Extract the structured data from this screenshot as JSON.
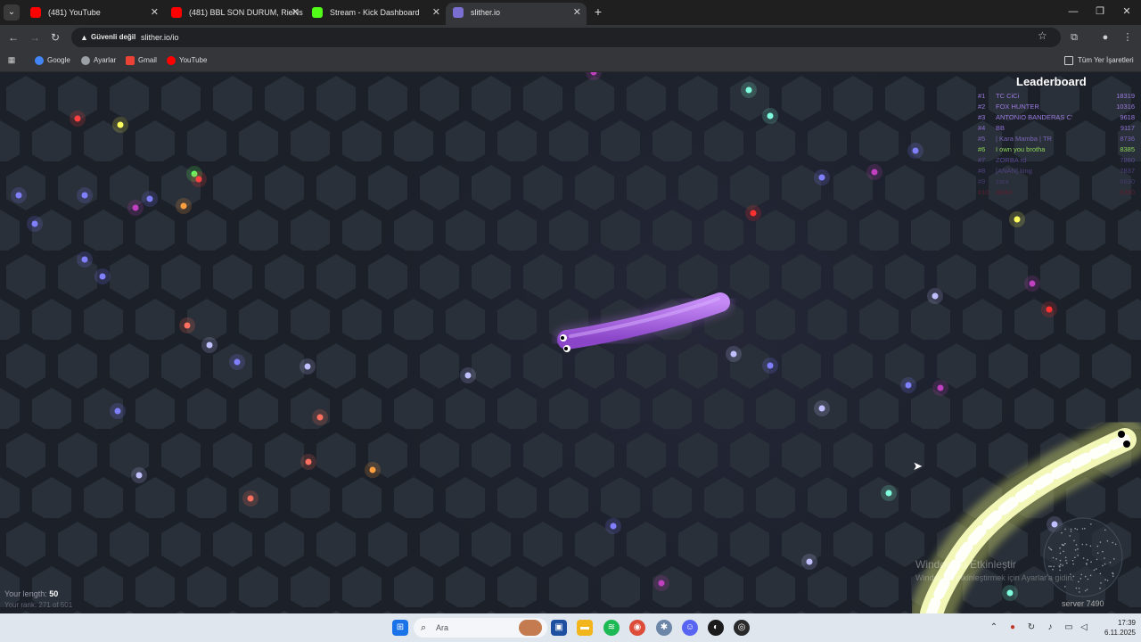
{
  "browser": {
    "tabs": [
      {
        "title": "(481) YouTube",
        "fav_color": "#ff0000",
        "active": false
      },
      {
        "title": "(481) BBL SON DURUM, RieNs",
        "fav_color": "#ff0000",
        "active": false
      },
      {
        "title": "Stream - Kick Dashboard",
        "fav_color": "#53fc18",
        "active": false
      },
      {
        "title": "slither.io",
        "fav_color": "#7a6fd0",
        "active": true
      }
    ],
    "insecure_label": "Güvenli değil",
    "url": "slither.io/io",
    "bookmarks": [
      {
        "label": "Google",
        "color": "#4285f4"
      },
      {
        "label": "Ayarlar",
        "color": "#9aa0a6"
      },
      {
        "label": "Gmail",
        "color": "#ea4335"
      },
      {
        "label": "YouTube",
        "color": "#ff0000"
      }
    ],
    "all_bookmarks_label": "Tüm Yer İşaretleri"
  },
  "leaderboard": {
    "title": "Leaderboard",
    "rows": [
      {
        "rank": "#1",
        "name": "TC CiCi",
        "score": "18319",
        "color": "#9b7be0"
      },
      {
        "rank": "#2",
        "name": "FOX HUNTER",
        "score": "10316",
        "color": "#9b7be0"
      },
      {
        "rank": "#3",
        "name": "ANTONIO BANDERAS C'",
        "score": "9618",
        "color": "#9b7be0"
      },
      {
        "rank": "#4",
        "name": "BB",
        "score": "9117",
        "color": "#8b70d0"
      },
      {
        "rank": "#5",
        "name": "| Kara Mamba | TR",
        "score": "8736",
        "color": "#7a64b8"
      },
      {
        "rank": "#6",
        "name": "I own you brotha",
        "score": "8385",
        "color": "#8bd35a"
      },
      {
        "rank": "#7",
        "name": "ZORBA rd",
        "score": "7860",
        "color": "#5a4a90"
      },
      {
        "rank": "#8",
        "name": "[ANAN] king",
        "score": "7837",
        "color": "#4f4280"
      },
      {
        "rank": "#9",
        "name": "zara",
        "score": "6630",
        "color": "#43396c"
      },
      {
        "rank": "#10",
        "name": "abdol",
        "score": "6380",
        "color": "#5a2030"
      }
    ]
  },
  "hud": {
    "length_label": "Your length:",
    "length_value": "50",
    "rank_text": "Your rank: 271 of 501",
    "server": "server 7490"
  },
  "watermark": {
    "line1": "Windows'u Etkinleştir",
    "line2": "Windows'u etkinleştirmek için Ayarlar'a gidin."
  },
  "taskbar": {
    "search_placeholder": "Ara",
    "time": "17:39",
    "date": "6.11.2025"
  }
}
